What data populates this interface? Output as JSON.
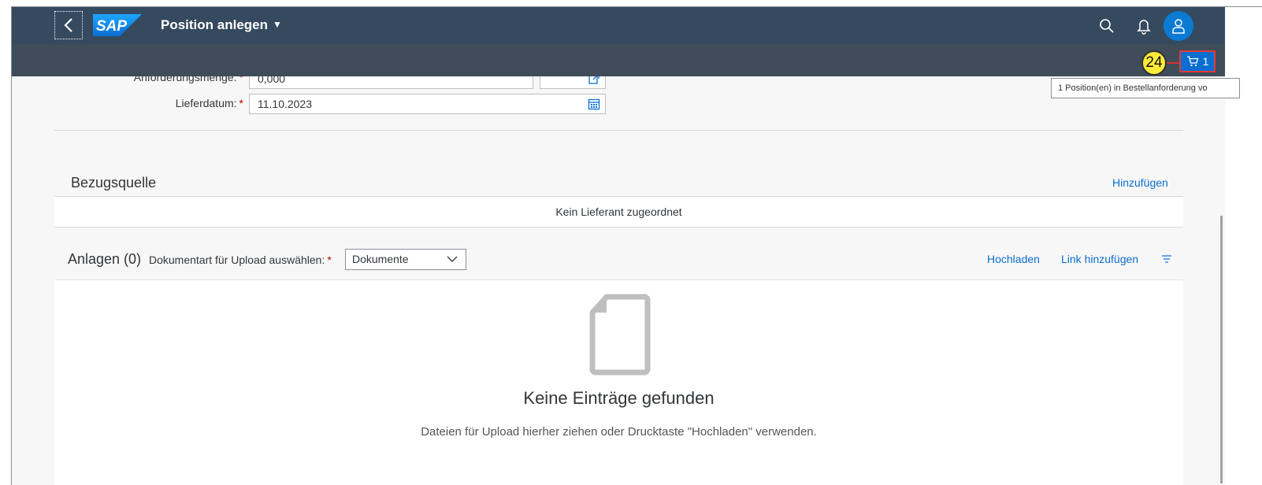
{
  "header": {
    "back_label": "Zurück",
    "logo_text": "SAP",
    "app_title": "Position anlegen",
    "search_icon": "search-icon",
    "notifications_icon": "bell-icon",
    "avatar_icon": "user-icon"
  },
  "toolbar": {
    "step_marker": "24",
    "cart_count": "1",
    "cart_tooltip": "1 Position(en) in Bestellanforderung vo"
  },
  "form": {
    "quantity_label": "Anforderungsmenge:",
    "quantity_value": "0,000",
    "delivery_label": "Lieferdatum:",
    "delivery_value": "11.10.2023"
  },
  "bezugsquelle": {
    "title": "Bezugsquelle",
    "add_link": "Hinzufügen",
    "empty_text": "Kein Lieferant zugeordnet"
  },
  "anlagen": {
    "title": "Anlagen (0)",
    "doc_type_label": "Dokumentart für Upload auswählen:",
    "doc_type_value": "Dokumente",
    "upload_link": "Hochladen",
    "add_link_label": "Link hinzufügen",
    "empty_title": "Keine Einträge gefunden",
    "empty_hint": "Dateien für Upload hierher ziehen oder Drucktaste \"Hochladen\" verwenden."
  },
  "colors": {
    "shell": "#354a5f",
    "accent": "#0a6ed1",
    "required": "#bb0000",
    "marker": "#ffeb3b"
  }
}
